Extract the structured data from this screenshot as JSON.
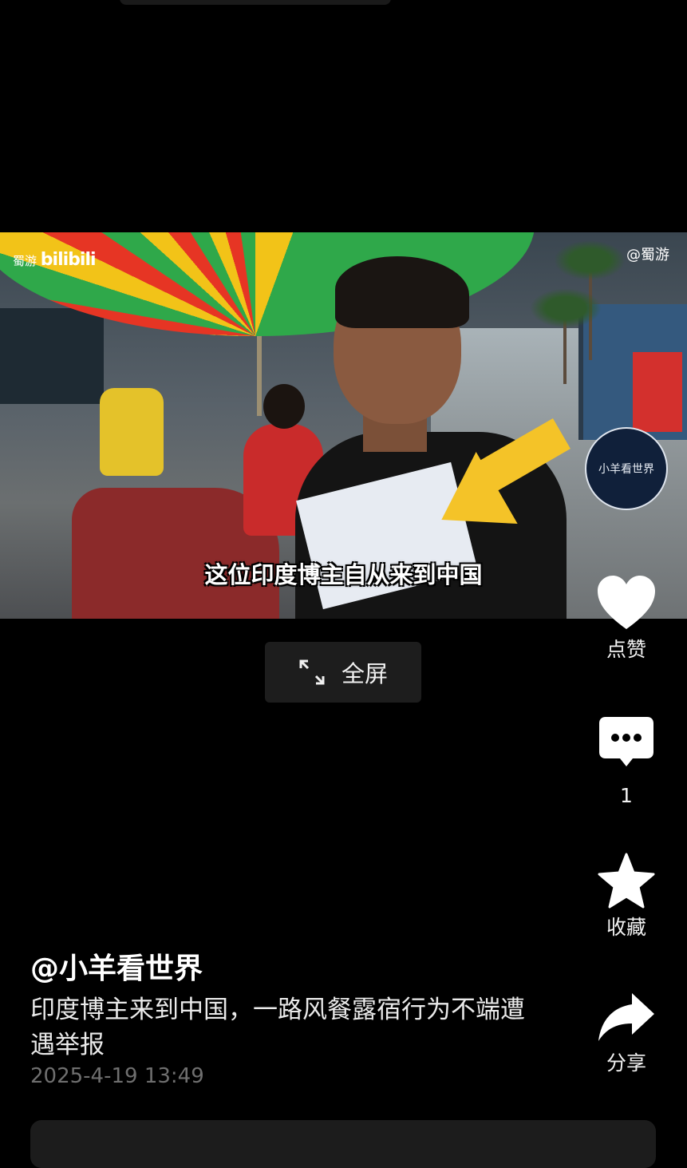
{
  "video": {
    "watermark_left_prefix": "蜀游",
    "watermark_left_brand": "bilibili",
    "watermark_right": "@蜀游",
    "channel_badge": "小羊看世界",
    "subtitle": "这位印度博主自从来到中国"
  },
  "fullscreen": {
    "label": "全屏",
    "icon": "expand-icon"
  },
  "actions": {
    "like": {
      "label": "点赞",
      "icon": "heart-icon"
    },
    "comment": {
      "count": "1",
      "icon": "comment-icon"
    },
    "favorite": {
      "label": "收藏",
      "icon": "star-icon"
    },
    "share": {
      "label": "分享",
      "icon": "share-icon"
    }
  },
  "post": {
    "author": "@小羊看世界",
    "description": "印度博主来到中国，一路风餐露宿行为不端遭遇举报",
    "date": "2025-4-19 13:49"
  },
  "colors": {
    "background": "#000000",
    "arrow": "#f4c328",
    "date_text": "#6f6f6f"
  }
}
